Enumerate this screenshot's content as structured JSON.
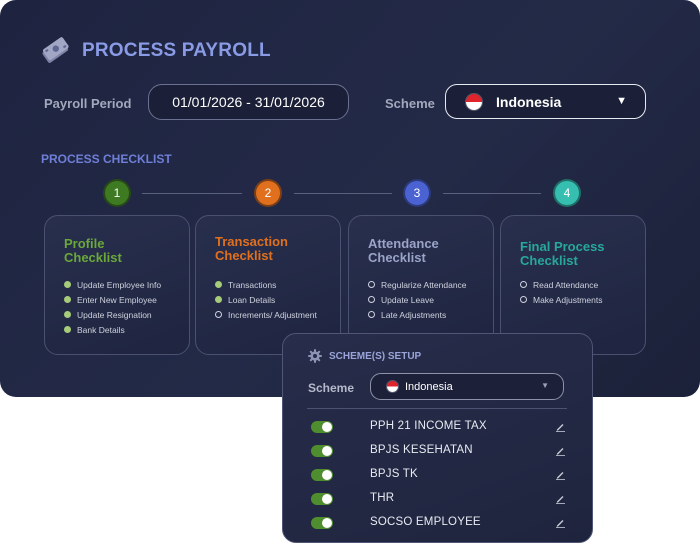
{
  "header": {
    "title": "PROCESS PAYROLL",
    "icon": "money-icon"
  },
  "period": {
    "label": "Payroll Period",
    "value": "01/01/2026 - 31/01/2026"
  },
  "scheme": {
    "label": "Scheme",
    "value": "Indonesia",
    "flag": "indonesia-flag-icon"
  },
  "checklist": {
    "heading": "PROCESS CHECKLIST",
    "steps": [
      {
        "number": "1",
        "color": "#3d7a22"
      },
      {
        "number": "2",
        "color": "#e0701e"
      },
      {
        "number": "3",
        "color": "#4a62d2"
      },
      {
        "number": "4",
        "color": "#36bfb0"
      }
    ],
    "cards": [
      {
        "title_line1": "Profile",
        "title_line2": "Checklist",
        "color": "#6aa83a",
        "items": [
          "Update Employee Info",
          "Enter New Employee",
          "Update Resignation",
          "Bank Details"
        ]
      },
      {
        "title_line1": "Transaction",
        "title_line2": "Checklist",
        "color": "#e0701e",
        "items": [
          "Transactions",
          "Loan Details",
          "Increments/ Adjustment"
        ]
      },
      {
        "title_line1": "Attendance",
        "title_line2": "Checklist",
        "color": "#9aa3c8",
        "items": [
          "Regularize Attendance",
          "Update Leave",
          "Late Adjustments"
        ]
      },
      {
        "title_line1": "Final Process",
        "title_line2": "Checklist",
        "color": "#27a89a",
        "items": [
          "Read Attendance",
          "Make Adjustments"
        ]
      }
    ]
  },
  "setup": {
    "title": "SCHEME(S) SETUP",
    "scheme_label": "Scheme",
    "scheme_value": "Indonesia",
    "items": [
      {
        "name": "PPH 21 INCOME TAX",
        "enabled": true
      },
      {
        "name": "BPJS KESEHATAN",
        "enabled": true
      },
      {
        "name": "BPJS TK",
        "enabled": true
      },
      {
        "name": "THR",
        "enabled": true
      },
      {
        "name": "SOCSO EMPLOYEE",
        "enabled": true
      }
    ]
  },
  "colors": {
    "accent": "#8a9be6",
    "toggle_on": "#4f8e2e",
    "completed_dot": "#a6cc7a"
  }
}
